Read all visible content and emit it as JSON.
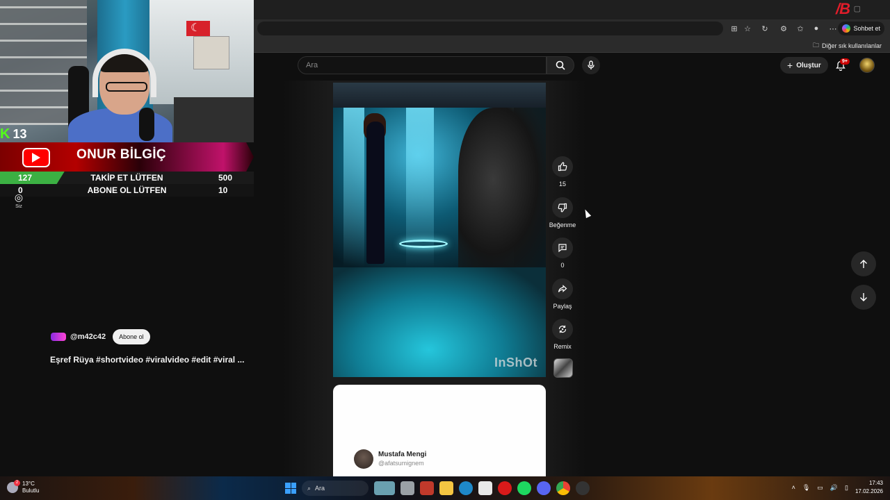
{
  "browser": {
    "bookmark_folder": "Diğer sık kullanılanlar",
    "chat_button": "Sohbet et"
  },
  "youtube": {
    "search_placeholder": "Ara",
    "create_label": "Oluştur",
    "notification_count": "9+"
  },
  "overlay": {
    "kick_count": "13",
    "streamer_name": "ONUR BİLGİÇ",
    "goals": [
      {
        "current": "127",
        "label": "TAKİP ET LÜTFEN",
        "target": "500",
        "progress": 0.254
      },
      {
        "current": "0",
        "label": "ABONE OL LÜTFEN",
        "target": "10",
        "progress": 0.0
      }
    ]
  },
  "sidebar": {
    "you_label": "Siz"
  },
  "short": {
    "channel_handle": "@m42c42",
    "subscribe_label": "Abone ol",
    "title": "Eşref Rüya #shortvideo #viralvideo #edit #viral ...",
    "watermark": "InShOt",
    "actions": {
      "like_count": "15",
      "dislike_label": "Beğenme",
      "comment_count": "0",
      "share_label": "Paylaş",
      "remix_label": "Remix"
    }
  },
  "next_short": {
    "name": "Mustafa Mengi",
    "handle": "@afatsumignem"
  },
  "taskbar": {
    "weather_temp": "13°C",
    "weather_desc": "Bulutlu",
    "weather_badge": "2",
    "search_label": "Ara",
    "time": "17:43",
    "date": "17.02.2026"
  }
}
